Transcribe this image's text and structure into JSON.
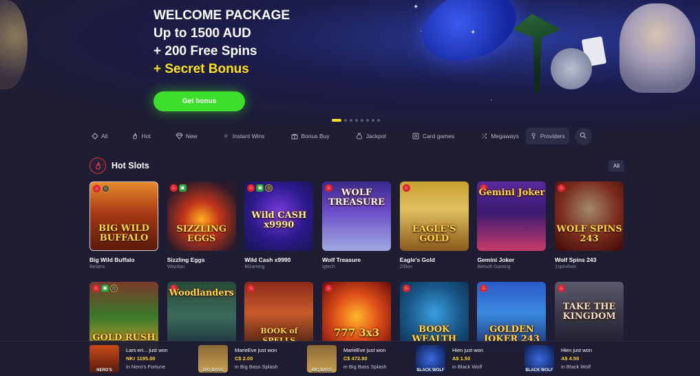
{
  "hero": {
    "line1": "WELCOME PACKAGE",
    "line2": "Up to 1500 AUD",
    "line3": "+ 200 Free Spins",
    "line4": "+ Secret Bonus",
    "cta": "Get bonus",
    "slide_count": 8,
    "active_slide": 1,
    "accent_yellow": "#ffe11a",
    "cta_green": "#3ce02a"
  },
  "categories": [
    {
      "label": "All",
      "icon": "diamond-outline-icon"
    },
    {
      "label": "Hot",
      "icon": "flame-icon"
    },
    {
      "label": "New",
      "icon": "gem-icon"
    },
    {
      "label": "Instant Wins",
      "icon": "sparkle-icon"
    },
    {
      "label": "Bonus Buy",
      "icon": "gift-icon"
    },
    {
      "label": "Jackpot",
      "icon": "money-bag-icon"
    },
    {
      "label": "Card games",
      "icon": "cards-icon"
    },
    {
      "label": "Megaways",
      "icon": "shuffle-icon"
    },
    {
      "label": "Providers",
      "icon": "key-icon"
    }
  ],
  "section": {
    "title": "Hot Slots",
    "all_label": "All"
  },
  "games_row1": [
    {
      "name": "Big Wild Buffalo",
      "provider": "Belatra",
      "art": "BIG WILD BUFFALO"
    },
    {
      "name": "Sizzling Eggs",
      "provider": "Wazdan",
      "art": "SIZZLING EGGS"
    },
    {
      "name": "Wild Cash x9990",
      "provider": "BGaming",
      "art": "Wild CASH x9990"
    },
    {
      "name": "Wolf Treasure",
      "provider": "igtech",
      "art": "WOLF TREASURE"
    },
    {
      "name": "Eagle's Gold",
      "provider": "Zillion",
      "art": "EAGLE'S GOLD"
    },
    {
      "name": "Gemini Joker",
      "provider": "Betsoft Gaming",
      "art": "Gemini Joker"
    },
    {
      "name": "Wolf Spins 243",
      "provider": "1spin4win",
      "art": "WOLF SPINS 243"
    }
  ],
  "games_row2": [
    {
      "art": "GOLD RUSH"
    },
    {
      "art": "Woodlanders"
    },
    {
      "art": "BOOK of SPELLS"
    },
    {
      "art": "777 3x3"
    },
    {
      "art": "BOOK WEALTH"
    },
    {
      "art": "GOLDEN JOKER 243"
    },
    {
      "art": "TAKE THE KINGDOM"
    }
  ],
  "winners": [
    {
      "who": "Lars eri... just won",
      "amount": "NKr 1195.00",
      "game": "in Nero's Fortune",
      "art": "NERO'S"
    },
    {
      "who": "MarieEve just won",
      "amount": "C$ 2.00",
      "game": "in Big Bass Splash",
      "art": "BIG BASS"
    },
    {
      "who": "MarieEve just won",
      "amount": "C$ 472.80",
      "game": "in Big Bass Splash",
      "art": "BIG BASS"
    },
    {
      "who": "Hien just won",
      "amount": "A$ 1.50",
      "game": "in Black Wolf",
      "art": "BLACK WOLF"
    },
    {
      "who": "Hien just won",
      "amount": "A$ 4.50",
      "game": "in Black Wolf",
      "art": "BLACK WOLF"
    }
  ]
}
